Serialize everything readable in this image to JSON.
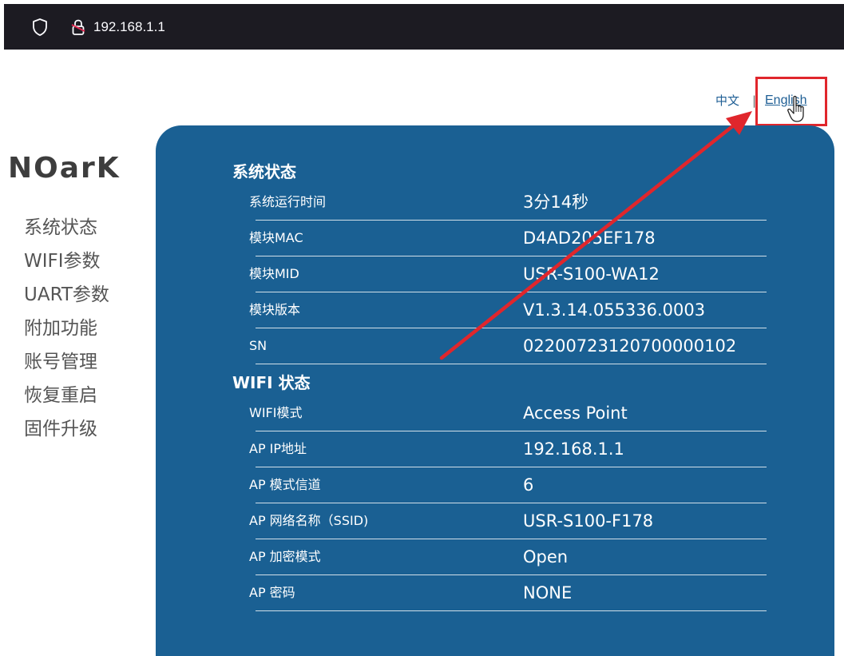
{
  "browser": {
    "url": "192.168.1.1",
    "shield_icon": "shield-icon",
    "lock_icon": "insecure-lock-icon"
  },
  "language": {
    "zh": "中文",
    "separator": "|",
    "en": "English"
  },
  "logo": "NOarK",
  "sidebar": {
    "items": [
      "系统状态",
      "WIFI参数",
      "UART参数",
      "附加功能",
      "账号管理",
      "恢复重启",
      "固件升级"
    ]
  },
  "system_status": {
    "title": "系统状态",
    "rows": [
      {
        "label": "系统运行时间",
        "value": "3分14秒"
      },
      {
        "label": "模块MAC",
        "value": "D4AD205EF178"
      },
      {
        "label": "模块MID",
        "value": "USR-S100-WA12"
      },
      {
        "label": "模块版本",
        "value": "V1.3.14.055336.0003"
      },
      {
        "label": "SN",
        "value": "02200723120700000102"
      }
    ]
  },
  "wifi_status": {
    "title": "WIFI 状态",
    "rows": [
      {
        "label": "WIFI模式",
        "value": "Access Point"
      },
      {
        "label": "AP IP地址",
        "value": "192.168.1.1"
      },
      {
        "label": "AP 模式信道",
        "value": "6"
      },
      {
        "label": "AP 网络名称（SSID)",
        "value": "USR-S100-F178"
      },
      {
        "label": "AP 加密模式",
        "value": "Open"
      },
      {
        "label": "AP 密码",
        "value": "NONE"
      }
    ]
  },
  "annotation": {
    "arrow_icon": "red-arrow",
    "cursor_icon": "hand-pointer-icon"
  },
  "colors": {
    "browser_bar": "#1c1b22",
    "panel": "#1a6093",
    "link": "#1f5f95",
    "sidebar_text": "#555555",
    "annotation_red": "#e0262c"
  }
}
